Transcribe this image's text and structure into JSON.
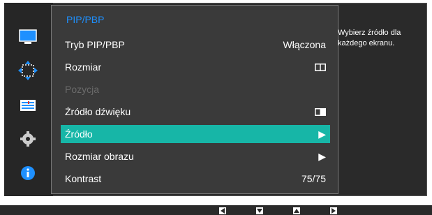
{
  "menu": {
    "title": "PIP/PBP",
    "items": [
      {
        "label": "Tryb PIP/PBP",
        "value": "Włączona"
      },
      {
        "label": "Rozmiar",
        "value_icon": "split-screen-icon"
      },
      {
        "label": "Pozycja",
        "disabled": true
      },
      {
        "label": "Źródło dźwięku",
        "value_icon": "audio-source-icon"
      },
      {
        "label": "Źródło",
        "selected": true,
        "value_icon": "right-arrow-icon"
      },
      {
        "label": "Rozmiar obrazu",
        "value_icon": "right-arrow-icon"
      },
      {
        "label": "Kontrast",
        "value": "75/75"
      }
    ]
  },
  "help": {
    "text": "Wybierz źródło dla każdego ekranu."
  },
  "sidebar": {
    "icons": [
      "monitor-icon",
      "move-arrows-icon",
      "settings-list-icon",
      "gear-icon",
      "info-icon"
    ]
  },
  "bottom_nav": {
    "buttons": [
      "left-button-icon",
      "down-button-icon",
      "up-button-icon",
      "right-button-icon"
    ]
  },
  "colors": {
    "accent": "#17b6a7",
    "title": "#1e90ff",
    "panel_bg": "#3a3a3a"
  }
}
